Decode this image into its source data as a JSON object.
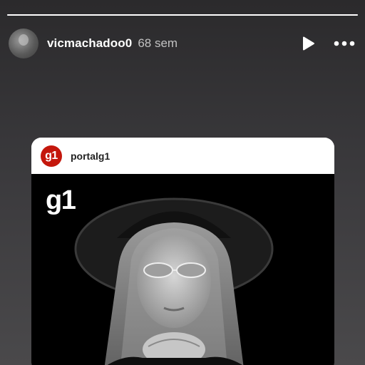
{
  "story": {
    "progress": 1.0
  },
  "header": {
    "username": "vicmachadoo0",
    "timestamp": "68 sem",
    "play_icon": "play-icon",
    "more_icon": "more-horizontal-icon"
  },
  "post": {
    "account": "portalg1",
    "logo_text": "g1",
    "brand_text": "g1",
    "brand_color": "#c4170c"
  }
}
